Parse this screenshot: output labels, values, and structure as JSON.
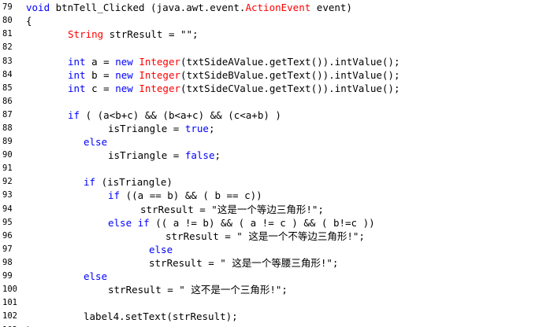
{
  "colors": {
    "keyword": "#0000ff",
    "type": "#ff0000",
    "plain": "#000000",
    "background": "#ffffff"
  },
  "lines": [
    {
      "num": "79",
      "indent": 0,
      "tokens": [
        {
          "t": "kw",
          "v": "void"
        },
        {
          "t": "pl",
          "v": " btnTell_Clicked (java.awt.event."
        },
        {
          "t": "ty",
          "v": "ActionEvent"
        },
        {
          "t": "pl",
          "v": " event)"
        }
      ]
    },
    {
      "num": "80",
      "indent": 0,
      "tokens": [
        {
          "t": "pl",
          "v": "{"
        }
      ]
    },
    {
      "num": "81",
      "indent": 1,
      "tokens": [
        {
          "t": "ty",
          "v": "String"
        },
        {
          "t": "pl",
          "v": " strResult = \"\";"
        }
      ]
    },
    {
      "num": "82",
      "indent": 0,
      "tokens": []
    },
    {
      "num": "83",
      "indent": 1,
      "tokens": [
        {
          "t": "kw",
          "v": "int"
        },
        {
          "t": "pl",
          "v": " a = "
        },
        {
          "t": "kw",
          "v": "new"
        },
        {
          "t": "pl",
          "v": " "
        },
        {
          "t": "ty",
          "v": "Integer"
        },
        {
          "t": "pl",
          "v": "(txtSideAValue.getText()).intValue();"
        }
      ]
    },
    {
      "num": "84",
      "indent": 1,
      "tokens": [
        {
          "t": "kw",
          "v": "int"
        },
        {
          "t": "pl",
          "v": " b = "
        },
        {
          "t": "kw",
          "v": "new"
        },
        {
          "t": "pl",
          "v": " "
        },
        {
          "t": "ty",
          "v": "Integer"
        },
        {
          "t": "pl",
          "v": "(txtSideBValue.getText()).intValue();"
        }
      ]
    },
    {
      "num": "85",
      "indent": 1,
      "tokens": [
        {
          "t": "kw",
          "v": "int"
        },
        {
          "t": "pl",
          "v": " c = "
        },
        {
          "t": "kw",
          "v": "new"
        },
        {
          "t": "pl",
          "v": " "
        },
        {
          "t": "ty",
          "v": "Integer"
        },
        {
          "t": "pl",
          "v": "(txtSideCValue.getText()).intValue();"
        }
      ]
    },
    {
      "num": "86",
      "indent": 0,
      "tokens": []
    },
    {
      "num": "87",
      "indent": 1,
      "tokens": [
        {
          "t": "kw",
          "v": "if"
        },
        {
          "t": "pl",
          "v": " ( (a<b+c) && (b<a+c) && (c<a+b) )"
        }
      ]
    },
    {
      "num": "88",
      "indent": 2,
      "tokens": [
        {
          "t": "pl",
          "v": "isTriangle = "
        },
        {
          "t": "kw",
          "v": "true"
        },
        {
          "t": "pl",
          "v": ";"
        }
      ]
    },
    {
      "num": "89",
      "indent": 3,
      "tokens": [
        {
          "t": "kw",
          "v": "else"
        }
      ]
    },
    {
      "num": "90",
      "indent": 2,
      "tokens": [
        {
          "t": "pl",
          "v": "isTriangle = "
        },
        {
          "t": "kw",
          "v": "false"
        },
        {
          "t": "pl",
          "v": ";"
        }
      ]
    },
    {
      "num": "91",
      "indent": 0,
      "tokens": []
    },
    {
      "num": "92",
      "indent": 3,
      "tokens": [
        {
          "t": "kw",
          "v": "if"
        },
        {
          "t": "pl",
          "v": " (isTriangle)"
        }
      ]
    },
    {
      "num": "93",
      "indent": 2,
      "tokens": [
        {
          "t": "kw",
          "v": "if"
        },
        {
          "t": "pl",
          "v": " ((a == b) && ( b == c))"
        }
      ]
    },
    {
      "num": "94",
      "indent": 4,
      "tokens": [
        {
          "t": "pl",
          "v": "strResult = \"这是一个等边三角形!\";"
        }
      ]
    },
    {
      "num": "95",
      "indent": 5,
      "tokens": [
        {
          "t": "kw",
          "v": "else if"
        },
        {
          "t": "pl",
          "v": " (( a != b) && ( a != c ) && ( b!=c ))"
        }
      ]
    },
    {
      "num": "96",
      "indent": 6,
      "tokens": [
        {
          "t": "pl",
          "v": "strResult = \" 这是一个不等边三角形!\";"
        }
      ]
    },
    {
      "num": "97",
      "indent": 7,
      "tokens": [
        {
          "t": "kw",
          "v": "else"
        }
      ]
    },
    {
      "num": "98",
      "indent": 7,
      "tokens": [
        {
          "t": "pl",
          "v": "strResult = \" 这是一个等腰三角形!\";"
        }
      ]
    },
    {
      "num": "99",
      "indent": 3,
      "tokens": [
        {
          "t": "kw",
          "v": "else"
        }
      ]
    },
    {
      "num": "100",
      "indent": 2,
      "tokens": [
        {
          "t": "pl",
          "v": "strResult = \" 这不是一个三角形!\";"
        }
      ]
    },
    {
      "num": "101",
      "indent": 0,
      "tokens": []
    },
    {
      "num": "102",
      "indent": 3,
      "tokens": [
        {
          "t": "pl",
          "v": "label4.setText(strResult);"
        }
      ]
    },
    {
      "num": "103",
      "indent": 0,
      "tokens": [
        {
          "t": "pl",
          "v": "}"
        }
      ]
    }
  ]
}
